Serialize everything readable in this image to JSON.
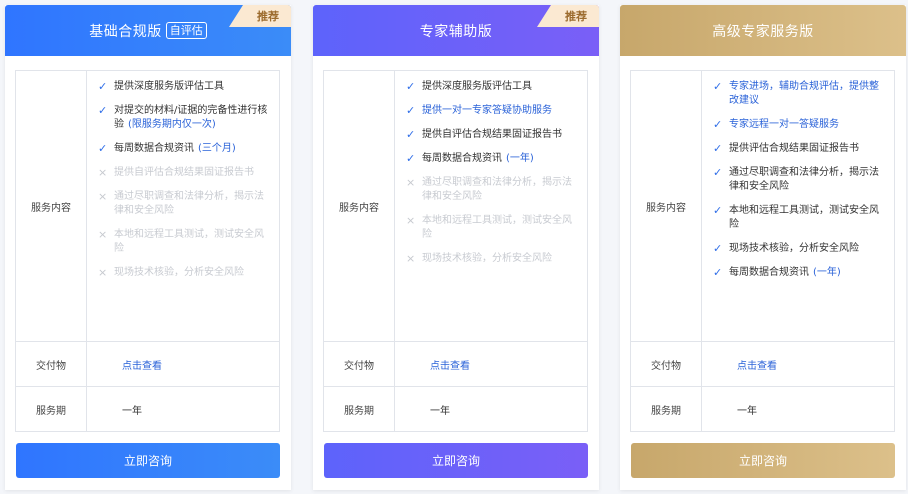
{
  "labels": {
    "service_content": "服务内容",
    "deliverables": "交付物",
    "service_period": "服务期"
  },
  "plans": [
    {
      "title": "基础合规版",
      "pill": "自评估",
      "ribbon": "推荐",
      "deliverable_link": "点击查看",
      "period": "一年",
      "cta": "立即咨询",
      "features": [
        {
          "text": "提供深度服务版评估工具",
          "note": "",
          "included": true,
          "highlight": false
        },
        {
          "text": "对提交的材料/证据的完备性进行核验",
          "note": "(限服务期内仅一次)",
          "included": true,
          "highlight": false
        },
        {
          "text": "每周数据合规资讯",
          "note": "(三个月)",
          "included": true,
          "highlight": false
        },
        {
          "text": "提供自评估合规结果固证报告书",
          "note": "",
          "included": false,
          "highlight": false
        },
        {
          "text": "通过尽职调查和法律分析，揭示法律和安全风险",
          "note": "",
          "included": false,
          "highlight": false
        },
        {
          "text": "本地和远程工具测试，测试安全风险",
          "note": "",
          "included": false,
          "highlight": false
        },
        {
          "text": "现场技术核验，分析安全风险",
          "note": "",
          "included": false,
          "highlight": false
        }
      ]
    },
    {
      "title": "专家辅助版",
      "pill": "",
      "ribbon": "推荐",
      "deliverable_link": "点击查看",
      "period": "一年",
      "cta": "立即咨询",
      "features": [
        {
          "text": "提供深度服务版评估工具",
          "note": "",
          "included": true,
          "highlight": false
        },
        {
          "text": "提供一对一专家答疑协助服务",
          "note": "",
          "included": true,
          "highlight": true
        },
        {
          "text": "提供自评估合规结果固证报告书",
          "note": "",
          "included": true,
          "highlight": false
        },
        {
          "text": "每周数据合规资讯",
          "note": "(一年)",
          "included": true,
          "highlight": false
        },
        {
          "text": "通过尽职调查和法律分析，揭示法律和安全风险",
          "note": "",
          "included": false,
          "highlight": false
        },
        {
          "text": "本地和远程工具测试，测试安全风险",
          "note": "",
          "included": false,
          "highlight": false
        },
        {
          "text": "现场技术核验，分析安全风险",
          "note": "",
          "included": false,
          "highlight": false
        }
      ]
    },
    {
      "title": "高级专家服务版",
      "pill": "",
      "ribbon": "",
      "deliverable_link": "点击查看",
      "period": "一年",
      "cta": "立即咨询",
      "features": [
        {
          "text": "专家进场，辅助合规评估，提供整改建议",
          "note": "",
          "included": true,
          "highlight": true
        },
        {
          "text": "专家远程一对一答疑服务",
          "note": "",
          "included": true,
          "highlight": true
        },
        {
          "text": "提供评估合规结果固证报告书",
          "note": "",
          "included": true,
          "highlight": false
        },
        {
          "text": "通过尽职调查和法律分析，揭示法律和安全风险",
          "note": "",
          "included": true,
          "highlight": false
        },
        {
          "text": "本地和远程工具测试，测试安全风险",
          "note": "",
          "included": true,
          "highlight": false
        },
        {
          "text": "现场技术核验，分析安全风险",
          "note": "",
          "included": true,
          "highlight": false
        },
        {
          "text": "每周数据合规资讯",
          "note": "(一年)",
          "included": true,
          "highlight": false
        }
      ]
    }
  ]
}
